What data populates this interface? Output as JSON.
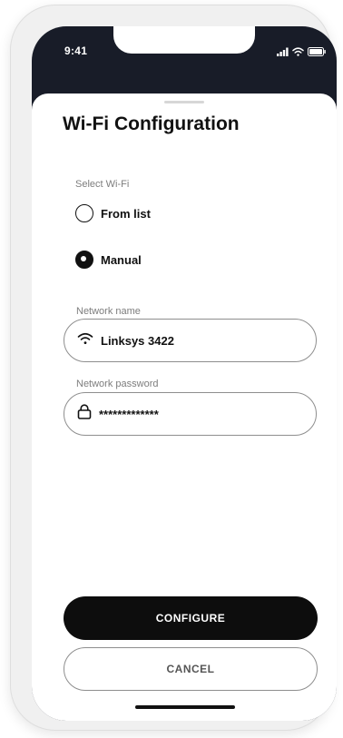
{
  "status_bar": {
    "time": "9:41",
    "icons": [
      "cellular-signal-icon",
      "wifi-icon",
      "battery-icon"
    ]
  },
  "sheet": {
    "title": "Wi-Fi Configuration",
    "select_label": "Select Wi-Fi",
    "options": [
      {
        "label": "From list",
        "selected": false
      },
      {
        "label": "Manual",
        "selected": true
      }
    ],
    "network_name": {
      "label": "Network name",
      "value": "Linksys 3422",
      "icon": "wifi-icon"
    },
    "network_password": {
      "label": "Network password",
      "value": "*************",
      "icon": "lock-icon"
    },
    "configure_label": "CONFIGURE",
    "cancel_label": "CANCEL"
  },
  "colors": {
    "header_background": "#181c28",
    "primary_button": "#0d0d0d",
    "text": "#111111",
    "muted_label": "#7d7d7d",
    "border": "#8e8e8e"
  }
}
